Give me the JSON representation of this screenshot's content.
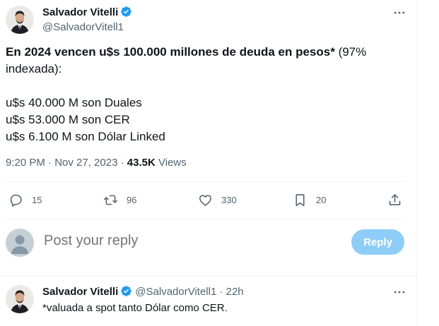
{
  "tweet": {
    "author_name": "Salvador Vitelli",
    "author_handle": "@SalvadorVitell1",
    "text_bold": "En 2024 vencen u$s 100.000 millones de deuda en pesos*",
    "text_rest": " (97%",
    "text_line2": "indexada):",
    "lines": [
      "u$s 40.000 M son Duales",
      "u$s 53.000 M son CER",
      "u$s 6.100 M son Dólar Linked"
    ],
    "timestamp": "9:20 PM · Nov 27, 2023 · ",
    "views_count": "43.5K",
    "views_label": " Views"
  },
  "actions": {
    "replies": "15",
    "reposts": "96",
    "likes": "330",
    "bookmarks": "20"
  },
  "reply_box": {
    "placeholder": "Post your reply",
    "button_label": "Reply"
  },
  "reply": {
    "author_name": "Salvador Vitelli",
    "author_handle": "@SalvadorVitell1",
    "time": " · 22h",
    "text": "*valuada a spot tanto Dólar como CER."
  },
  "colors": {
    "verified": "#1d9bf0",
    "reply_button": "#8ecdf8",
    "secondary_text": "#536471"
  },
  "icons": [
    "verified-badge-icon",
    "more-icon",
    "reply-icon",
    "repost-icon",
    "like-icon",
    "bookmark-icon",
    "share-icon",
    "default-avatar-icon"
  ]
}
